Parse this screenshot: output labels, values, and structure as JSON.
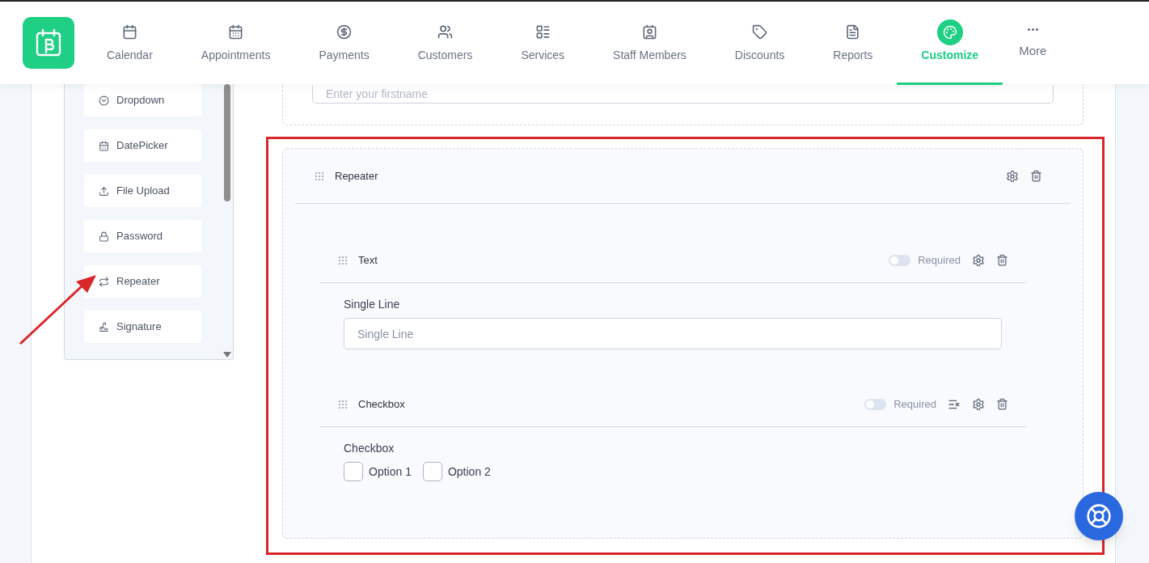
{
  "nav": {
    "items": [
      {
        "label": "Calendar",
        "selected": false
      },
      {
        "label": "Appointments",
        "selected": false
      },
      {
        "label": "Payments",
        "selected": false
      },
      {
        "label": "Customers",
        "selected": false
      },
      {
        "label": "Services",
        "selected": false
      },
      {
        "label": "Staff Members",
        "selected": false
      },
      {
        "label": "Discounts",
        "selected": false
      },
      {
        "label": "Reports",
        "selected": false
      },
      {
        "label": "Customize",
        "selected": true
      }
    ],
    "more": "More"
  },
  "palette": {
    "items": [
      {
        "label": "Dropdown"
      },
      {
        "label": "DatePicker"
      },
      {
        "label": "File Upload"
      },
      {
        "label": "Password"
      },
      {
        "label": "Repeater"
      },
      {
        "label": "Signature"
      }
    ]
  },
  "form": {
    "top_field": {
      "placeholder": "Enter your firstname"
    },
    "repeater": {
      "title": "Repeater",
      "fields": [
        {
          "kind": "text",
          "title": "Text",
          "required": false,
          "required_label": "Required",
          "label": "Single Line",
          "placeholder": "Single Line"
        },
        {
          "kind": "checkbox",
          "title": "Checkbox",
          "required": false,
          "required_label": "Required",
          "label": "Checkbox",
          "options": [
            {
              "label": "Option 1",
              "checked": false
            },
            {
              "label": "Option 2",
              "checked": false
            }
          ]
        }
      ]
    }
  }
}
